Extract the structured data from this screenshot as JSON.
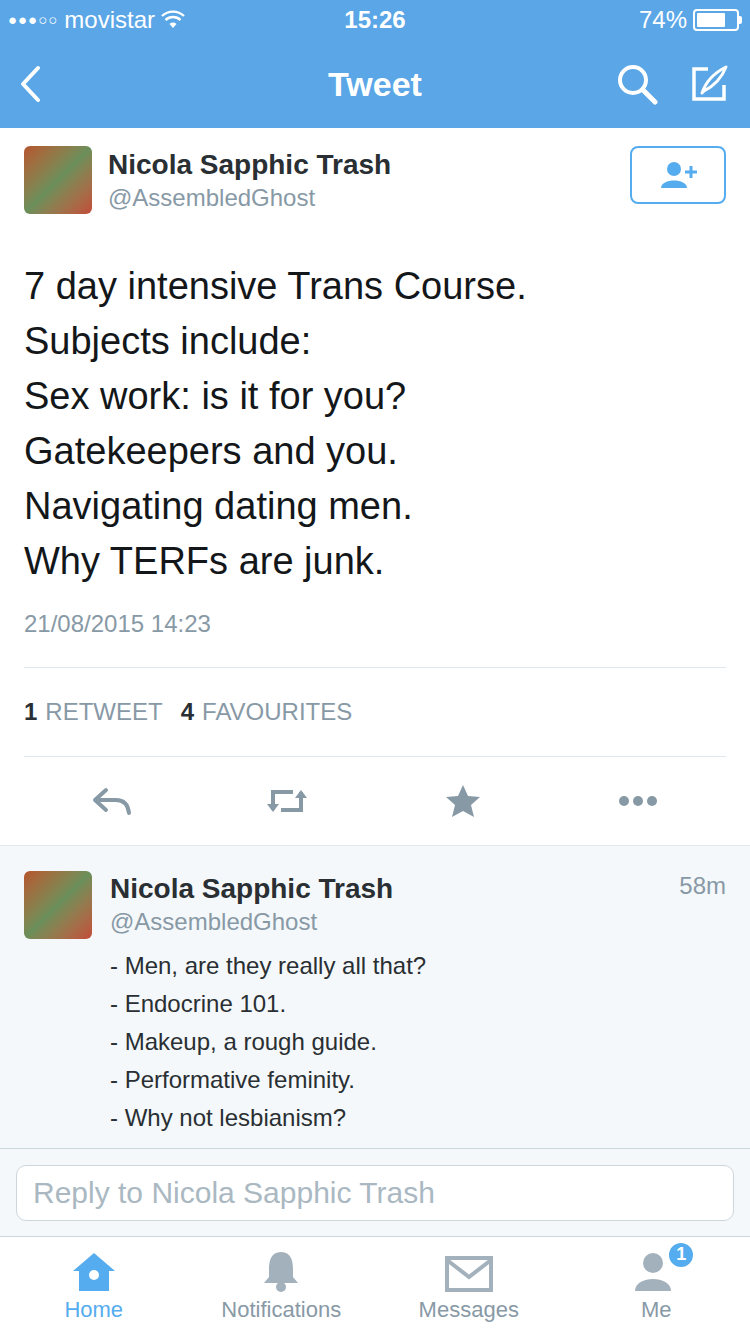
{
  "status_bar": {
    "signal": "●●●○○",
    "carrier": "movistar",
    "time": "15:26",
    "battery": "74%",
    "battery_level": 0.74
  },
  "nav": {
    "title": "Tweet"
  },
  "tweet": {
    "name": "Nicola Sapphic Trash",
    "handle": "@AssembledGhost",
    "lines": [
      "7 day intensive Trans Course.",
      "Subjects include:",
      "Sex work: is it for you?",
      "Gatekeepers and you.",
      "Navigating dating men.",
      "Why TERFs are junk."
    ],
    "timestamp": "21/08/2015 14:23",
    "retweets": "1",
    "retweets_label": "RETWEET",
    "favourites": "4",
    "favourites_label": "FAVOURITES"
  },
  "reply": {
    "name": "Nicola Sapphic Trash",
    "handle": "@AssembledGhost",
    "time": "58m",
    "lines": [
      "- Men, are they really all that?",
      "- Endocrine 101.",
      "- Makeup, a rough guide.",
      "- Performative feminity.",
      "- Why not lesbianism?"
    ]
  },
  "composer": {
    "placeholder": "Reply to Nicola Sapphic Trash"
  },
  "tabs": [
    {
      "label": "Home",
      "selected": true
    },
    {
      "label": "Notifications",
      "selected": false
    },
    {
      "label": "Messages",
      "selected": false
    },
    {
      "label": "Me",
      "selected": false,
      "badge": "1"
    }
  ]
}
